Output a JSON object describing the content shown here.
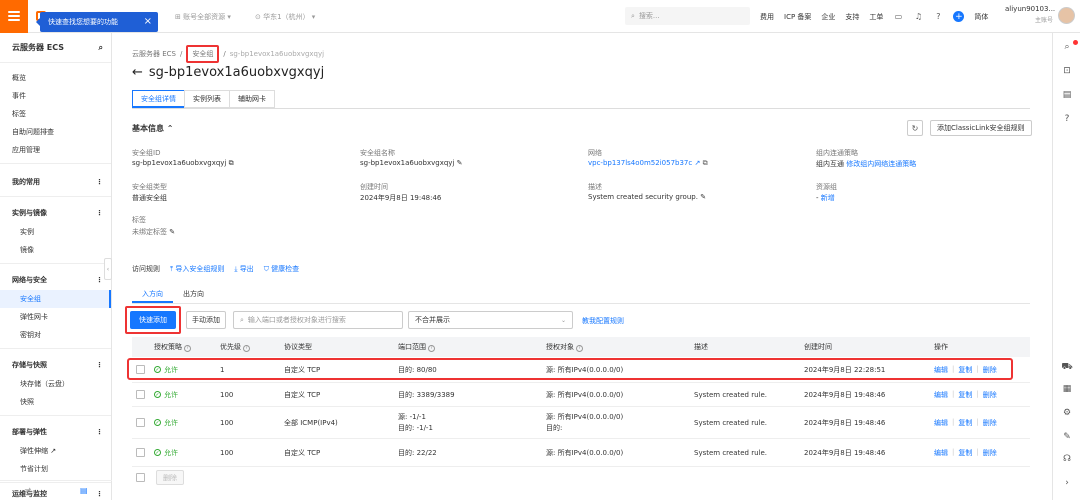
{
  "topbar": {
    "tooltip": "快速查找您想要的功能",
    "account": "账号全部资源",
    "region": "华东1（杭州）",
    "search_placeholder": "搜索...",
    "links": [
      "费用",
      "ICP 备案",
      "企业",
      "支持",
      "工单"
    ],
    "lang": "简体",
    "user_name": "aliyun90103...",
    "user_role": "主账号"
  },
  "sidebar": {
    "title": "云服务器 ECS",
    "top_items": [
      "概览",
      "事件",
      "标签",
      "自助问题排查",
      "应用管理"
    ],
    "my_common": "我的常用",
    "groups": [
      {
        "label": "实例与镜像",
        "items": [
          "实例",
          "镜像"
        ]
      },
      {
        "label": "网络与安全",
        "items": [
          "安全组",
          "弹性网卡",
          "密钥对"
        ]
      },
      {
        "label": "存储与快照",
        "items": [
          "块存储（云盘）",
          "快照"
        ]
      },
      {
        "label": "部署与弹性",
        "items": [
          "弹性伸缩",
          "节省计划"
        ]
      },
      {
        "label": "运维与监控",
        "items": []
      }
    ]
  },
  "breadcrumb": {
    "root": "云服务器 ECS",
    "current": "安全组",
    "leaf": "sg-bp1evox1a6uobxvgxqyj"
  },
  "page": {
    "title": "sg-bp1evox1a6uobxvgxqyj"
  },
  "tabs": [
    "安全组详情",
    "实例列表",
    "辅助网卡"
  ],
  "basic": {
    "heading": "基本信息",
    "classic_btn": "添加ClassicLink安全组规则",
    "fields": [
      {
        "label": "安全组ID",
        "value": "sg-bp1evox1a6uobxvgxqyj"
      },
      {
        "label": "安全组名称",
        "value": "sg-bp1evox1a6uobxvgxqyj"
      },
      {
        "label": "网络",
        "value": "vpc-bp137ls4o0m52i057b37c"
      },
      {
        "label": "组内连通策略",
        "value": "组内互通",
        "link": "修改组内网络连通策略"
      },
      {
        "label": "安全组类型",
        "value": "普通安全组"
      },
      {
        "label": "创建时间",
        "value": "2024年9月8日 19:48:46"
      },
      {
        "label": "描述",
        "value": "System created security group."
      },
      {
        "label": "资源组",
        "value": "-",
        "link": "新增"
      },
      {
        "label": "标签",
        "value": "未绑定标签"
      }
    ]
  },
  "access": {
    "label": "访问规则",
    "import": "导入安全组规则",
    "export": "导出",
    "health": "健康检查"
  },
  "direction": {
    "in": "入方向",
    "out": "出方向"
  },
  "toolbar": {
    "quick_add": "快速添加",
    "manual_add": "手动添加",
    "search_placeholder": "输入端口或者授权对象进行搜索",
    "merge_select": "不合并展示",
    "rule_link": "教我配置规则"
  },
  "table": {
    "headers": [
      "授权策略",
      "优先级",
      "协议类型",
      "端口范围",
      "授权对象",
      "描述",
      "创建时间",
      "操作"
    ],
    "rows": [
      {
        "policy": "允许",
        "priority": "1",
        "protocol": "自定义 TCP",
        "port": "目的: 80/80",
        "port2": "",
        "object": "源: 所有IPv4(0.0.0.0/0)",
        "object2": "",
        "desc": "",
        "time": "2024年9月8日 22:28:51"
      },
      {
        "policy": "允许",
        "priority": "100",
        "protocol": "自定义 TCP",
        "port": "目的: 3389/3389",
        "port2": "",
        "object": "源: 所有IPv4(0.0.0.0/0)",
        "object2": "",
        "desc": "System created rule.",
        "time": "2024年9月8日 19:48:46"
      },
      {
        "policy": "允许",
        "priority": "100",
        "protocol": "全部 ICMP(IPv4)",
        "port": "源: -1/-1",
        "port2": "目的: -1/-1",
        "object": "源: 所有IPv4(0.0.0.0/0)",
        "object2": "目的:",
        "desc": "System created rule.",
        "time": "2024年9月8日 19:48:46"
      },
      {
        "policy": "允许",
        "priority": "100",
        "protocol": "自定义 TCP",
        "port": "目的: 22/22",
        "port2": "",
        "object": "源: 所有IPv4(0.0.0.0/0)",
        "object2": "",
        "desc": "System created rule.",
        "time": "2024年9月8日 19:48:46"
      }
    ],
    "ops": [
      "编辑",
      "复制",
      "删除"
    ],
    "delete_btn": "删除"
  },
  "colors": {
    "accent": "#1677ff",
    "brand": "#ff6a00",
    "highlight": "#e33333"
  }
}
